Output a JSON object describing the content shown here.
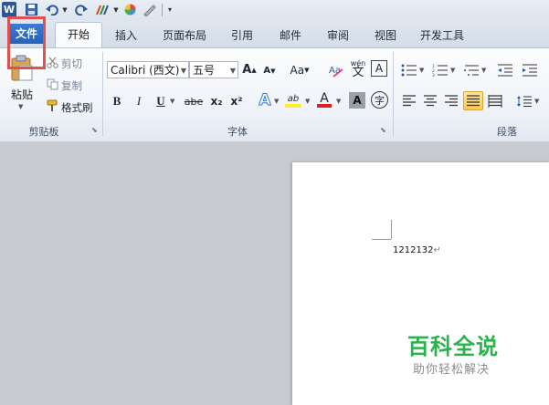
{
  "qat": {
    "word_icon": "W",
    "save_icon": "save-icon",
    "undo_icon": "undo-icon",
    "redo_icon": "redo-icon"
  },
  "tabs": {
    "file": "文件",
    "home": "开始",
    "insert": "插入",
    "layout": "页面布局",
    "references": "引用",
    "mailings": "邮件",
    "review": "审阅",
    "view": "视图",
    "developer": "开发工具"
  },
  "clipboard": {
    "paste": "粘贴",
    "cut": "剪切",
    "copy": "复制",
    "format_painter": "格式刷",
    "group_label": "剪贴板"
  },
  "font": {
    "font_name": "Calibri (西文)",
    "font_size": "五号",
    "grow": "A",
    "shrink": "A",
    "change_case": "Aa",
    "clear_format": "A",
    "pinyin": "wén",
    "pinyin_char": "文",
    "border_char": "A",
    "bold": "B",
    "italic": "I",
    "underline": "U",
    "strike": "abe",
    "subscript": "x₂",
    "superscript": "x²",
    "text_effect": "A",
    "highlight": "ab",
    "font_color": "A",
    "char_shading": "A",
    "enclose": "字",
    "group_label": "字体"
  },
  "paragraph": {
    "group_label": "段落"
  },
  "document": {
    "text": "1212132",
    "para_mark": "↵"
  },
  "watermark": {
    "title": "百科全说",
    "subtitle": "助你轻松解决"
  },
  "colors": {
    "file_tab": "#2a66bc",
    "highlight_box": "#e15050",
    "watermark_green": "#2bb24c"
  }
}
